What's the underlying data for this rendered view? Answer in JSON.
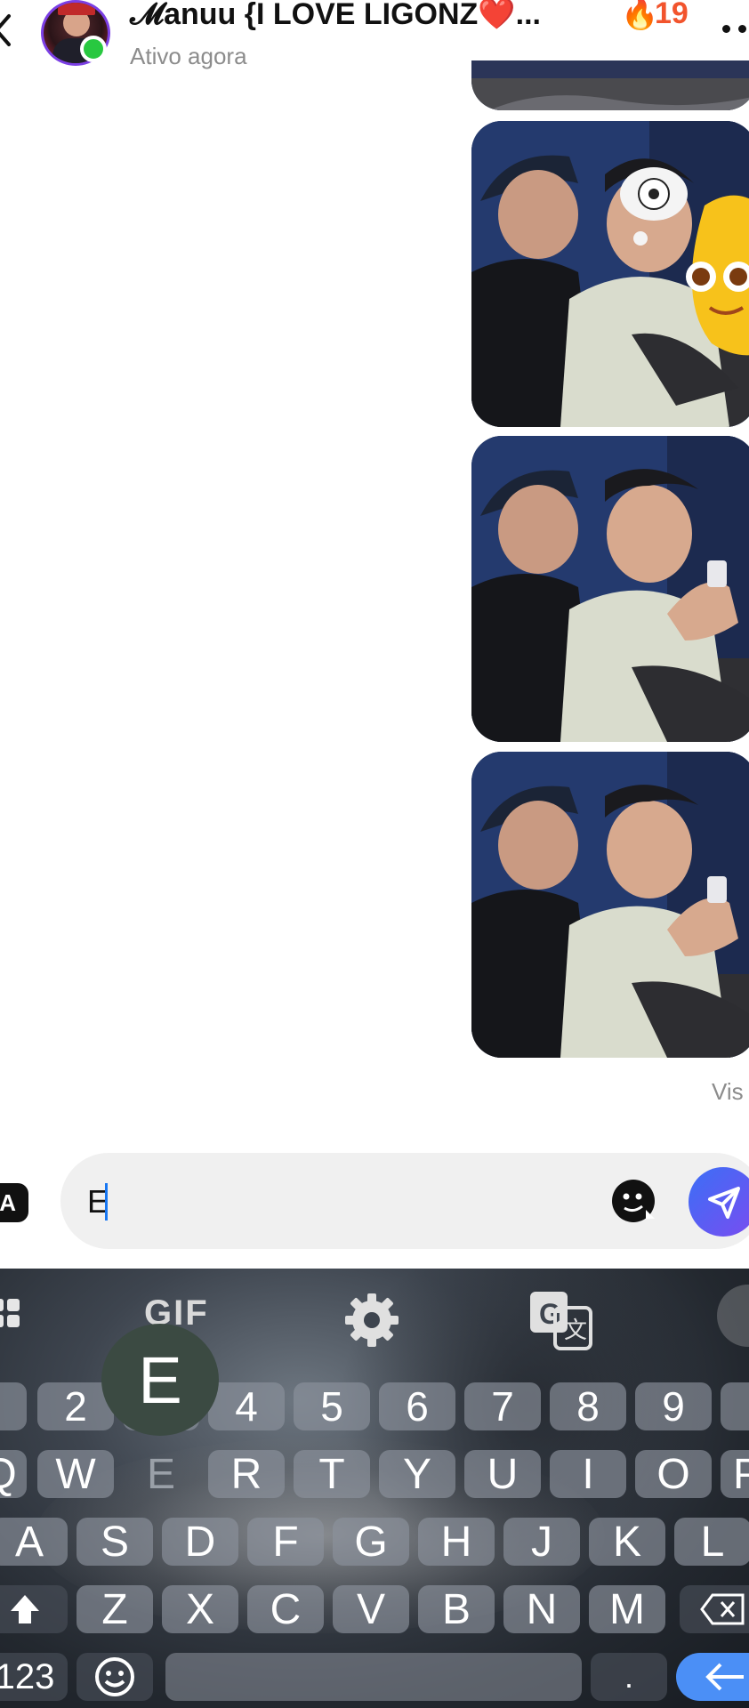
{
  "header": {
    "contact_name": "𝓜anuu {I LOVE LIGONZ❤️...",
    "status": "Ativo agora",
    "streak_icon": "🔥",
    "streak_count": "19"
  },
  "conversation": {
    "seen_label": "Vis"
  },
  "composer": {
    "left_label": "A",
    "input_value": "E"
  },
  "keyboard": {
    "toolbar_gif": "GIF",
    "popup_letter": "E",
    "number_row": [
      "",
      "2",
      "",
      "4",
      "5",
      "6",
      "7",
      "8",
      "9",
      ""
    ],
    "row1": [
      "Q",
      "W",
      "E",
      "R",
      "T",
      "Y",
      "U",
      "I",
      "O",
      "P"
    ],
    "row2": [
      "A",
      "S",
      "D",
      "F",
      "G",
      "H",
      "J",
      "K",
      "L"
    ],
    "row3": [
      "Z",
      "X",
      "C",
      "V",
      "B",
      "N",
      "M"
    ],
    "symbols_label": "123",
    "period_label": "."
  },
  "colors": {
    "accent": "#1877f2",
    "online": "#28c840",
    "streak": "#f2542d",
    "enter_key": "#4b8ff6"
  }
}
